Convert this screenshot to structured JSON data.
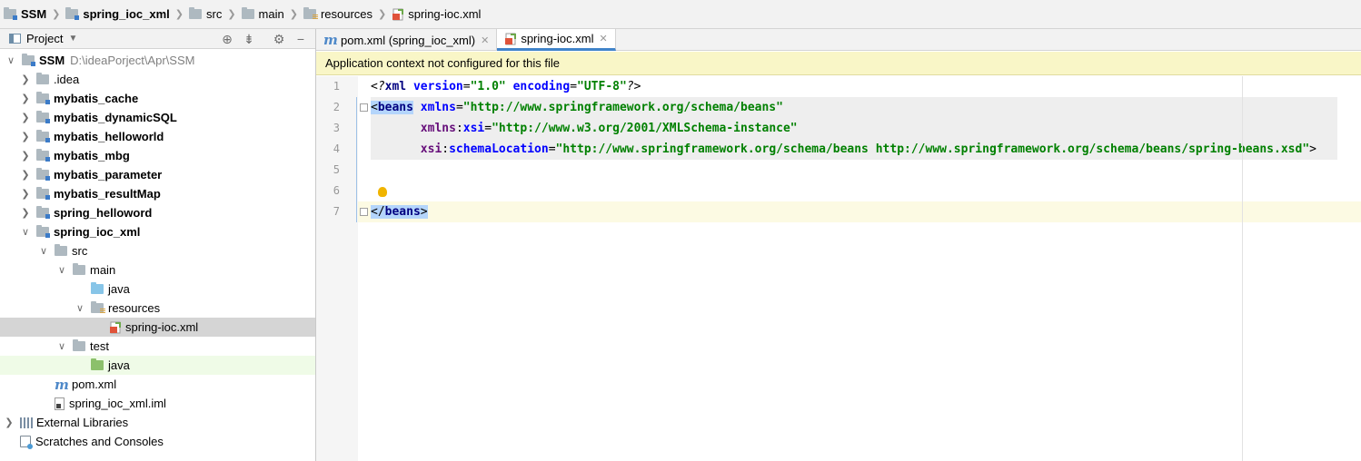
{
  "breadcrumb": [
    {
      "label": "SSM",
      "icon": "module-folder-icon",
      "bold": true
    },
    {
      "label": "spring_ioc_xml",
      "icon": "module-folder-icon",
      "bold": true
    },
    {
      "label": "src",
      "icon": "folder-icon"
    },
    {
      "label": "main",
      "icon": "folder-icon"
    },
    {
      "label": "resources",
      "icon": "resources-folder-icon"
    },
    {
      "label": "spring-ioc.xml",
      "icon": "spring-xml-icon"
    }
  ],
  "project_panel": {
    "title": "Project",
    "tree": [
      {
        "label": "SSM",
        "extra": "D:\\ideaPorject\\Apr\\SSM",
        "arrow": "expanded",
        "icon": "module-folder-icon",
        "bold": true
      },
      {
        "label": ".idea",
        "arrow": "collapsed",
        "icon": "folder-icon"
      },
      {
        "label": "mybatis_cache",
        "arrow": "collapsed",
        "icon": "module-folder-icon",
        "bold": true
      },
      {
        "label": "mybatis_dynamicSQL",
        "arrow": "collapsed",
        "icon": "module-folder-icon",
        "bold": true
      },
      {
        "label": "mybatis_helloworld",
        "arrow": "collapsed",
        "icon": "module-folder-icon",
        "bold": true
      },
      {
        "label": "mybatis_mbg",
        "arrow": "collapsed",
        "icon": "module-folder-icon",
        "bold": true
      },
      {
        "label": "mybatis_parameter",
        "arrow": "collapsed",
        "icon": "module-folder-icon",
        "bold": true
      },
      {
        "label": "mybatis_resultMap",
        "arrow": "collapsed",
        "icon": "module-folder-icon",
        "bold": true
      },
      {
        "label": "spring_helloword",
        "arrow": "collapsed",
        "icon": "module-folder-icon",
        "bold": true
      },
      {
        "label": "spring_ioc_xml",
        "arrow": "expanded",
        "icon": "module-folder-icon",
        "bold": true
      },
      {
        "label": "src",
        "arrow": "expanded",
        "icon": "folder-icon"
      },
      {
        "label": "main",
        "arrow": "expanded",
        "icon": "folder-icon"
      },
      {
        "label": "java",
        "arrow": "none",
        "icon": "source-folder-icon"
      },
      {
        "label": "resources",
        "arrow": "expanded",
        "icon": "resources-folder-icon"
      },
      {
        "label": "spring-ioc.xml",
        "arrow": "none",
        "icon": "spring-xml-icon",
        "selected": true
      },
      {
        "label": "test",
        "arrow": "expanded",
        "icon": "folder-icon"
      },
      {
        "label": "java",
        "arrow": "none",
        "icon": "test-folder-icon",
        "highlight": true
      },
      {
        "label": "pom.xml",
        "arrow": "none",
        "icon": "maven-icon"
      },
      {
        "label": "spring_ioc_xml.iml",
        "arrow": "none",
        "icon": "iml-file-icon"
      },
      {
        "label": "External Libraries",
        "arrow": "collapsed",
        "icon": "library-icon"
      },
      {
        "label": "Scratches and Consoles",
        "arrow": "none",
        "icon": "scratches-icon"
      }
    ]
  },
  "tabs": [
    {
      "label": "pom.xml (spring_ioc_xml)",
      "icon": "maven-icon",
      "active": false
    },
    {
      "label": "spring-ioc.xml",
      "icon": "spring-xml-icon",
      "active": true
    }
  ],
  "banner": "Application context not configured for this file",
  "editor": {
    "line_numbers": [
      "1",
      "2",
      "3",
      "4",
      "5",
      "6",
      "7"
    ],
    "line1": {
      "pi_open": "<?",
      "tag": "xml",
      "a1": "version",
      "v1": "\"1.0\"",
      "a2": "encoding",
      "v2": "\"UTF-8\"",
      "pi_close": "?>"
    },
    "line2": {
      "open": "<",
      "tag": "beans",
      "attr": "xmlns",
      "val": "\"http://www.springframework.org/schema/beans\""
    },
    "line3": {
      "ns": "xmlns",
      "attr": "xsi",
      "val": "\"http://www.w3.org/2001/XMLSchema-instance\""
    },
    "line4": {
      "ns": "xsi",
      "attr": "schemaLocation",
      "val": "\"http://www.springframework.org/schema/beans http://www.springframework.org/schema/beans/spring-beans.xsd\"",
      "close": ">"
    },
    "line7": {
      "open": "</",
      "tag": "beans",
      "close": ">"
    }
  },
  "colors": {
    "accent": "#4083c9",
    "banner_bg": "#f9f6c7",
    "selection": "#b4d5fb"
  }
}
